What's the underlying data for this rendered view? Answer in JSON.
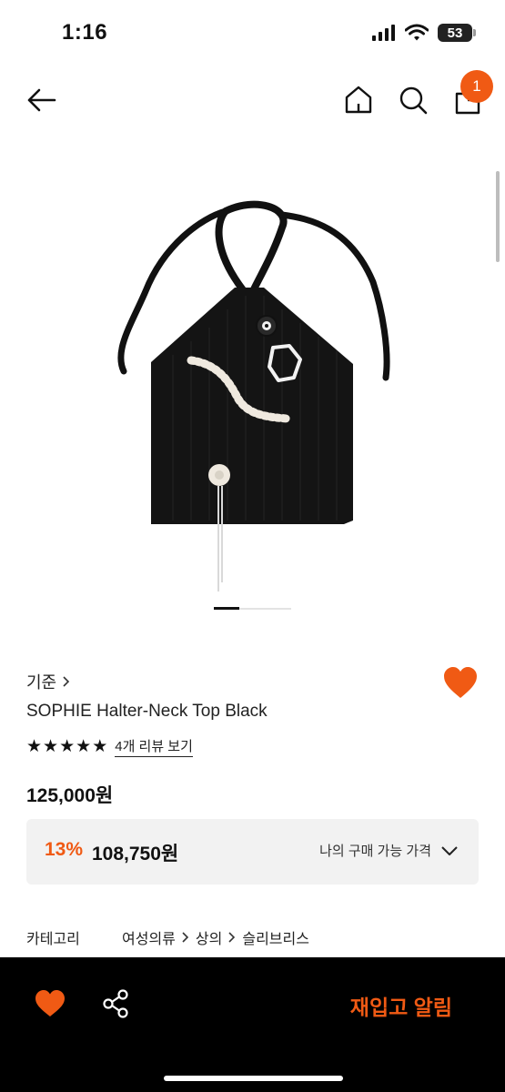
{
  "status_bar": {
    "time": "1:16",
    "battery": "53"
  },
  "header": {
    "cart_count": "1"
  },
  "product": {
    "brand": "기준",
    "name": "SOPHIE Halter-Neck Top Black",
    "rating_stars": 5,
    "review_link": "4개 리뷰 보기",
    "price": "125,000원",
    "discount_percent": "13%",
    "discount_price": "108,750원",
    "discount_toggle_label": "나의 구매 가능 가격"
  },
  "category": {
    "label": "카테고리",
    "path": [
      "여성의류",
      "상의",
      "슬리브리스"
    ]
  },
  "bottom_bar": {
    "restock_label": "재입고 알림"
  },
  "colors": {
    "accent": "#f05a14",
    "bottom_bar_bg": "#000000"
  },
  "icons": [
    "back-arrow-icon",
    "home-icon",
    "search-icon",
    "shopping-bag-icon",
    "heart-icon",
    "share-icon",
    "chevron-right-icon",
    "chevron-down-icon",
    "star-icon"
  ]
}
